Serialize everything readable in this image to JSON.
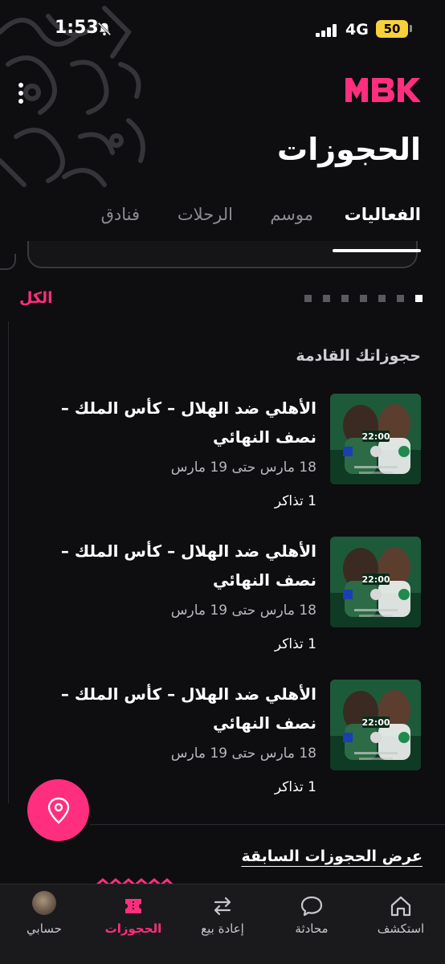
{
  "status_bar": {
    "time": "1:53",
    "network": "4G",
    "battery": "50"
  },
  "header": {
    "title": "الحجوزات",
    "logo_icon": "mbk-logo",
    "more_icon": "more-vertical-icon"
  },
  "tabs": [
    {
      "label": "الفعاليات",
      "active": true
    },
    {
      "label": "موسم",
      "active": false
    },
    {
      "label": "الرحلات",
      "active": false
    },
    {
      "label": "فنادق",
      "active": false
    }
  ],
  "carousel": {
    "dot_count": 7,
    "active_index": 0
  },
  "filter": {
    "all_label": "الكل"
  },
  "section": {
    "upcoming_title": "حجوزاتك القادمة"
  },
  "bookings": [
    {
      "title": "الأهلي ضد الهلال – كأس الملك – نصف النهائي",
      "dates": "18 مارس حتى 19 مارس",
      "tickets": "1 تذاكر",
      "thumb_time": "22:00"
    },
    {
      "title": "الأهلي ضد الهلال – كأس الملك – نصف النهائي",
      "dates": "18 مارس حتى 19 مارس",
      "tickets": "1 تذاكر",
      "thumb_time": "22:00"
    },
    {
      "title": "الأهلي ضد الهلال – كأس الملك – نصف النهائي",
      "dates": "18 مارس حتى 19 مارس",
      "tickets": "1 تذاكر",
      "thumb_time": "22:00"
    }
  ],
  "past_link": "عرض الحجوزات السابقة",
  "bottom_nav": [
    {
      "label": "استكشف",
      "icon": "home-icon",
      "active": false
    },
    {
      "label": "محادثة",
      "icon": "chat-icon",
      "active": false
    },
    {
      "label": "إعادة بيع",
      "icon": "resale-arrows-icon",
      "active": false
    },
    {
      "label": "الحجوزات",
      "icon": "ticket-icon",
      "active": true
    },
    {
      "label": "حسابي",
      "icon": "avatar",
      "active": false
    }
  ],
  "colors": {
    "accent": "#ff2e7e",
    "background": "#0e0d10",
    "nav_bg": "#1a191c"
  }
}
